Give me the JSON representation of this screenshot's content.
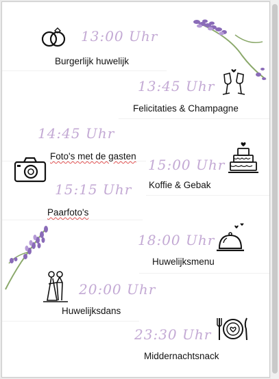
{
  "schedule": [
    {
      "time": "13:00 Uhr",
      "label": "Burgerlijk huwelijk",
      "icon": "rings-icon"
    },
    {
      "time": "13:45 Uhr",
      "label": "Felicitaties & Champagne",
      "icon": "champagne-icon"
    },
    {
      "time": "14:45 Uhr",
      "label": "Foto's met de gasten",
      "icon": "camera-icon"
    },
    {
      "time": "15:00 Uhr",
      "label": "Koffie & Gebak",
      "icon": "cake-icon"
    },
    {
      "time": "15:15 Uhr",
      "label": "Paarfoto's",
      "icon": "camera-icon"
    },
    {
      "time": "18:00 Uhr",
      "label": "Huwelijksmenu",
      "icon": "cloche-icon"
    },
    {
      "time": "20:00 Uhr",
      "label": "Huwelijksdans",
      "icon": "dancing-couple-icon"
    },
    {
      "time": "23:30 Uhr",
      "label": "Middernachtsnack",
      "icon": "plate-icon"
    }
  ],
  "colors": {
    "time": "#c3a9d4",
    "lavender": "#8a6bb8",
    "stem": "#8aa86a"
  }
}
